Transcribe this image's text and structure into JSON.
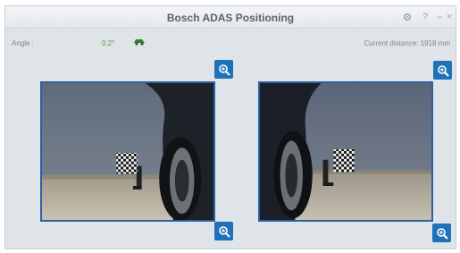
{
  "window": {
    "title": "Bosch ADAS Positioning",
    "controls": {
      "settings_icon": "gear-icon",
      "help_label": "?",
      "minimize_label": "–",
      "close_label": "×"
    }
  },
  "info": {
    "angle_label": "Angle :",
    "angle_value": "0.2°",
    "distance_label": "Current distance: 1918 mm"
  },
  "cameras": [
    {
      "name": "left camera view",
      "zoom_icon": "zoom-in-icon"
    },
    {
      "name": "right camera view",
      "zoom_icon": "zoom-in-icon"
    }
  ],
  "colors": {
    "accent": "#1f72b8",
    "frame_border": "#2c61a5",
    "angle_ok": "#4f9a3f",
    "background": "#dfe4e9"
  }
}
